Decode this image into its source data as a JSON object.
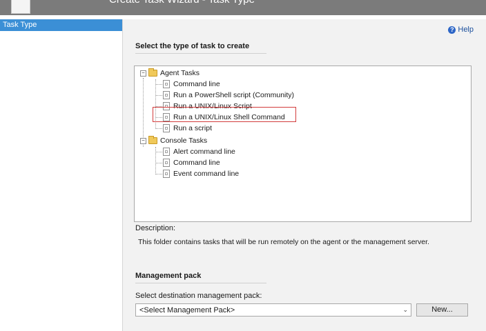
{
  "title_bar": {
    "title": "Create Task Wizard - Task Type"
  },
  "sidebar": {
    "items": [
      {
        "label": "Task Type"
      }
    ]
  },
  "help": {
    "label": "Help"
  },
  "task_section": {
    "title": "Select the type of task to create"
  },
  "tree": {
    "agent_tasks": {
      "label": "Agent Tasks",
      "children": [
        {
          "label": "Command line"
        },
        {
          "label": "Run a PowerShell script (Community)"
        },
        {
          "label": "Run a UNIX/Linux Script"
        },
        {
          "label": "Run a UNIX/Linux Shell Command"
        },
        {
          "label": "Run a script"
        }
      ]
    },
    "console_tasks": {
      "label": "Console Tasks",
      "children": [
        {
          "label": "Alert command line"
        },
        {
          "label": "Command line"
        },
        {
          "label": "Event command line"
        }
      ]
    }
  },
  "description": {
    "label": "Description:",
    "text": "This folder contains tasks that will be run remotely on the agent or the management server."
  },
  "management_pack": {
    "title": "Management pack",
    "field_label": "Select destination management pack:",
    "select_value": "<Select Management Pack>",
    "new_button": "New..."
  },
  "colors": {
    "selection": "#3b8fd6",
    "highlight_box": "#d23b3b",
    "title_bar": "#7b7b7b"
  },
  "icons": {
    "help": "help-icon",
    "folder": "folder-icon",
    "task": "task-icon",
    "dropdown": "chevron-down-icon"
  }
}
